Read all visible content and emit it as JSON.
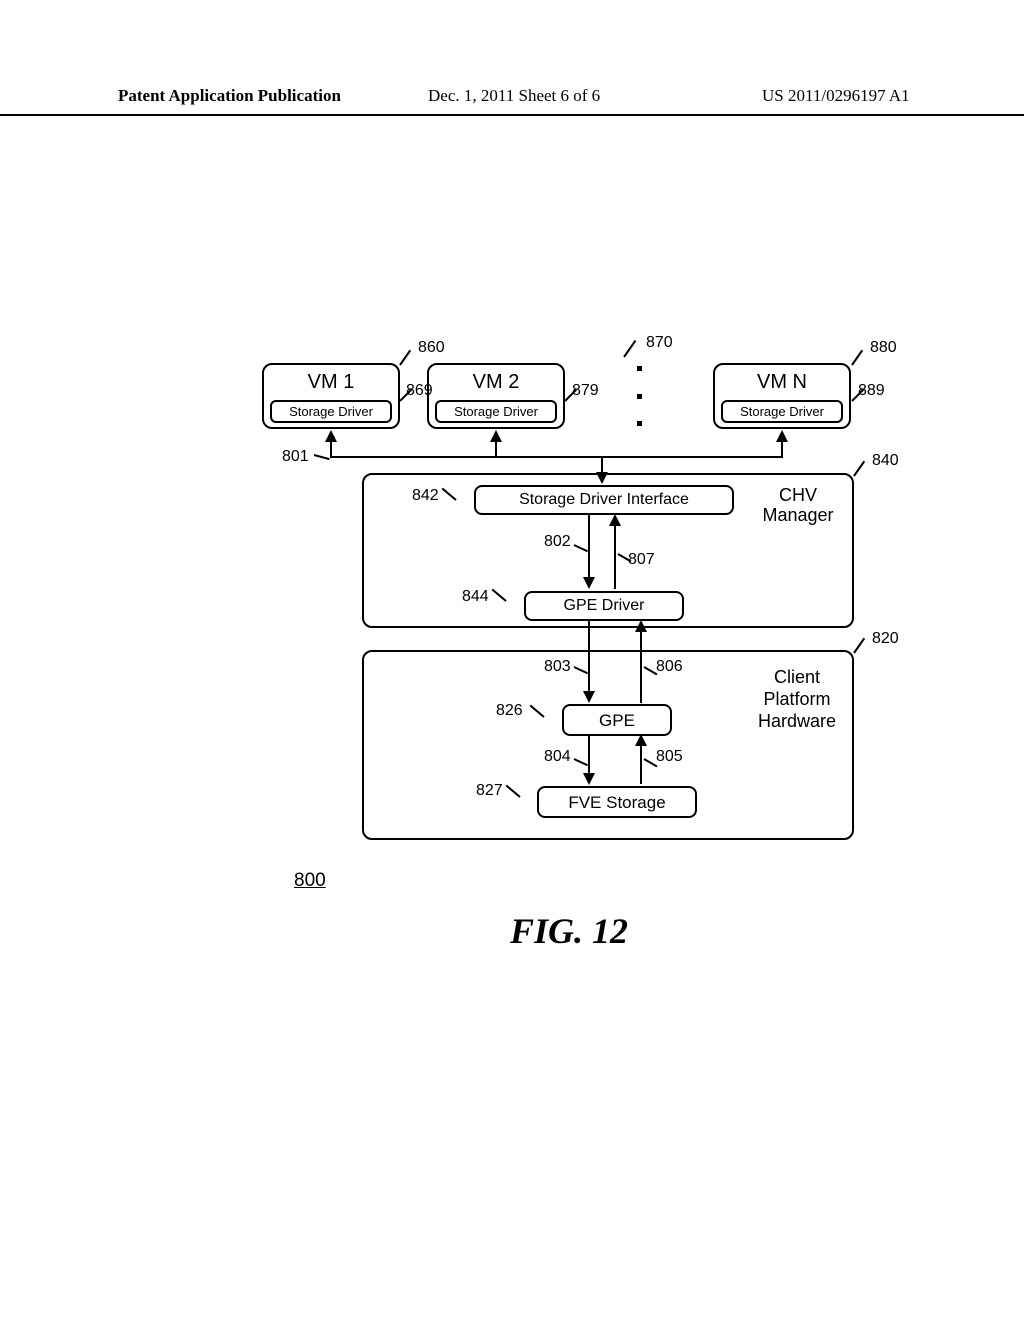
{
  "header": {
    "left": "Patent Application Publication",
    "mid": "Dec. 1, 2011   Sheet 6 of 6",
    "right": "US 2011/0296197 A1"
  },
  "boxes": {
    "vm1": {
      "title": "VM 1",
      "driver": "Storage Driver"
    },
    "vm2": {
      "title": "VM 2",
      "driver": "Storage Driver"
    },
    "vmN": {
      "title": "VM N",
      "driver": "Storage Driver"
    },
    "chv": {
      "title": "CHV Manager",
      "sdi": "Storage Driver Interface",
      "gped": "GPE Driver"
    },
    "client": {
      "title": "Client Platform Hardware",
      "gpe": "GPE",
      "fve": "FVE Storage"
    }
  },
  "refs": {
    "r860": "860",
    "r869": "869",
    "r870": "870",
    "r879": "879",
    "r880": "880",
    "r889": "889",
    "r840": "840",
    "r842": "842",
    "r844": "844",
    "r820": "820",
    "r826": "826",
    "r827": "827",
    "r801": "801",
    "r802": "802",
    "r807": "807",
    "r803": "803",
    "r806": "806",
    "r804": "804",
    "r805": "805",
    "r800": "800"
  },
  "figure": {
    "title": "FIG. 12"
  }
}
